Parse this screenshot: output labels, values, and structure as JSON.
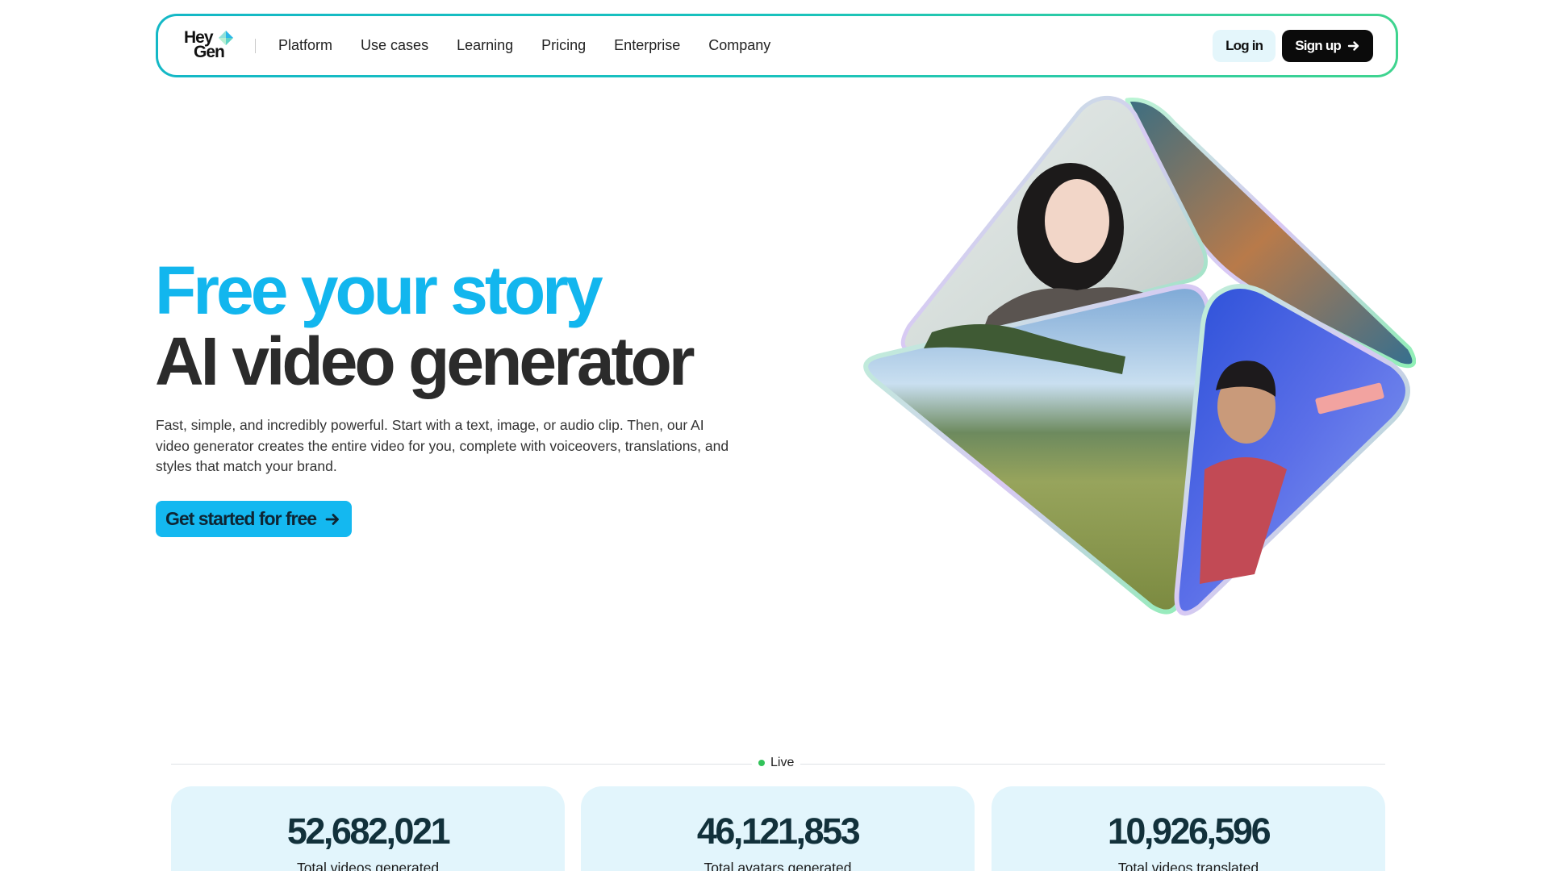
{
  "nav": {
    "logo_line1": "Hey",
    "logo_line2": "Gen",
    "links": [
      "Platform",
      "Use cases",
      "Learning",
      "Pricing",
      "Enterprise",
      "Company"
    ],
    "login_label": "Log in",
    "signup_label": "Sign up"
  },
  "hero": {
    "title_line1": "Free your story",
    "title_line2": "AI video generator",
    "description": "Fast, simple, and incredibly powerful. Start with a text, image, or audio clip. Then, our AI video generator creates the entire video for you, complete with voiceovers, translations, and styles that match your brand.",
    "cta_label": "Get started for free"
  },
  "stats": {
    "live_label": "Live",
    "items": [
      {
        "value": "52,682,021",
        "label": "Total videos generated"
      },
      {
        "value": "46,121,853",
        "label": "Total avatars generated"
      },
      {
        "value": "10,926,596",
        "label": "Total videos translated"
      }
    ]
  },
  "icons": [
    "logo-mark-icon",
    "arrow-right-icon",
    "live-dot-icon"
  ],
  "colors": {
    "accent": "#14b8f0",
    "title_blue": "#12b6ee",
    "stat_card_bg": "#e2f5fc",
    "nav_border_start": "#14b8c6",
    "nav_border_end": "#3fd48f",
    "signup_bg": "#0b0b0b",
    "live_dot": "#32c35a"
  }
}
